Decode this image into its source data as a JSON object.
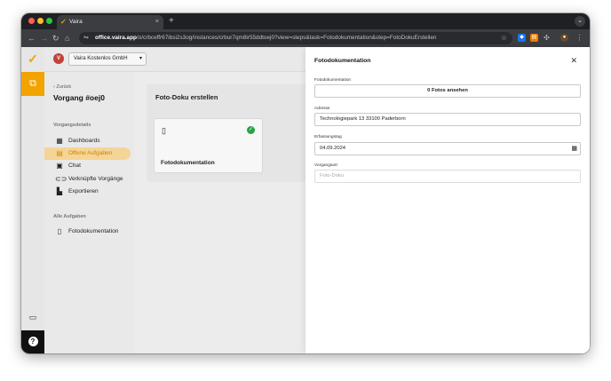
{
  "browser": {
    "tab_title": "Vaira",
    "tab_close": "×",
    "new_tab": "+",
    "url_host": "office.vaira.app",
    "url_path": "/o/crbceffr67ibsi2s3og/instances/crbur7qm8ir55ddtoej0?view=steps&task=Fotodokumentation&step=FotoDokuErstellen"
  },
  "app": {
    "company_avatar": "V",
    "company_name": "Vaira Kostenlos GmbH",
    "back_label": "Zurück",
    "case_title": "Vorgang #oej0",
    "section_details": "Vorgangsdetails",
    "nav_items": [
      {
        "label": "Dashboards",
        "icon": "dashboard-icon"
      },
      {
        "label": "Offene Aufgaben",
        "icon": "tasks-icon"
      },
      {
        "label": "Chat",
        "icon": "chat-icon"
      },
      {
        "label": "Verknüpfte Vorgänge",
        "icon": "link-icon"
      },
      {
        "label": "Exportieren",
        "icon": "export-icon"
      }
    ],
    "section_all_tasks": "Alle Aufgaben",
    "all_tasks": [
      {
        "label": "Fotodokumentation",
        "icon": "document-icon"
      }
    ],
    "content_title": "Foto-Doku erstellen",
    "task_card_title": "Fotodokumentation"
  },
  "drawer": {
    "title": "Fotodokumentation",
    "fields": {
      "fotos_label": "Fotodokumentation",
      "fotos_button": "0 Fotos ansehen",
      "adresse_label": "Adresse",
      "adresse_value": "Technologiepark 13 33100 Paderborn",
      "datum_label": "Erfassungstag",
      "datum_value": "04.09.2024",
      "vorgangsart_label": "Vorgangsart",
      "vorgangsart_placeholder": "Foto-Doku"
    }
  },
  "colors": {
    "accent": "#f2a300",
    "active_bg": "#f5d497",
    "success": "#27a348",
    "chrome_dark": "#1f2024"
  }
}
